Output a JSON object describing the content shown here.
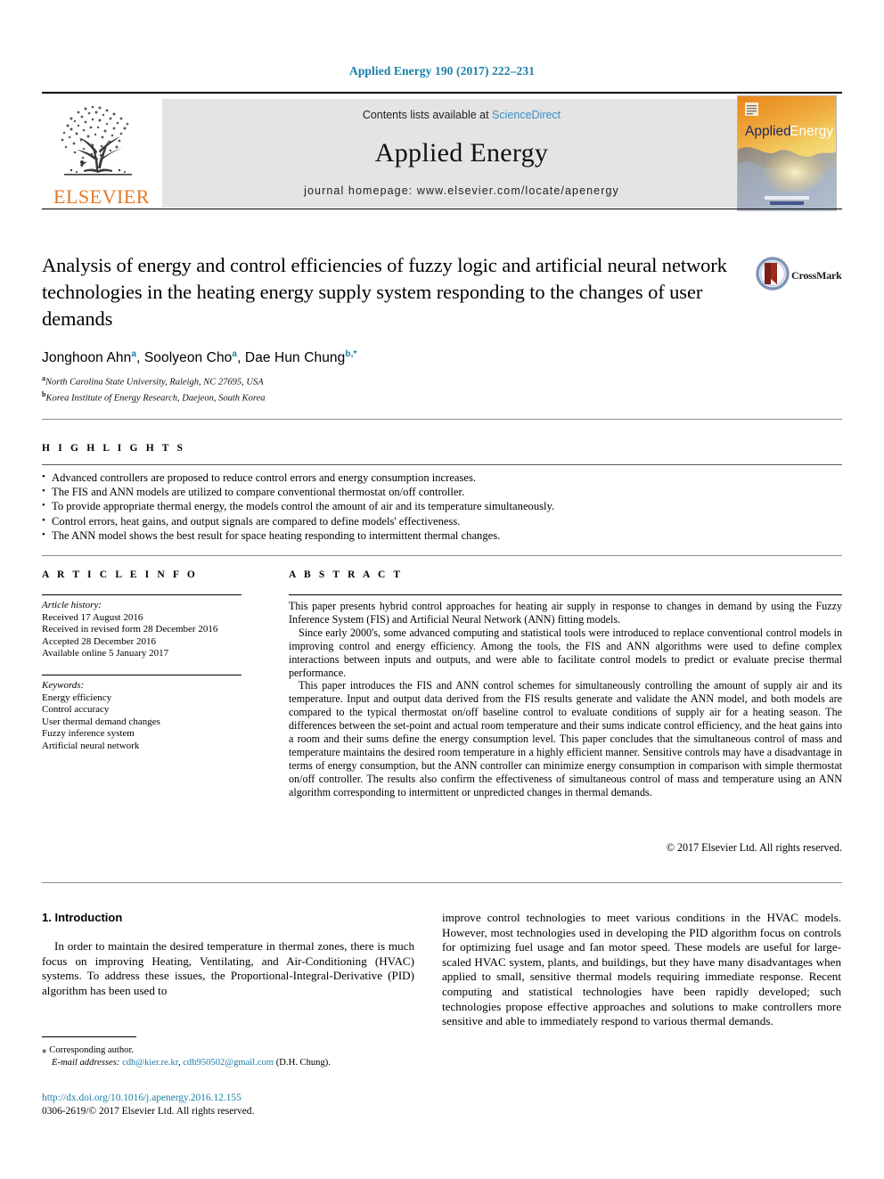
{
  "running_head": "Applied Energy 190 (2017) 222–231",
  "masthead": {
    "publisher": "ELSEVIER",
    "contents_prefix": "Contents lists available at ",
    "contents_link": "ScienceDirect",
    "journal_title": "Applied Energy",
    "homepage": "journal homepage: www.elsevier.com/locate/apenergy",
    "cover_title_first": "Applied",
    "cover_title_second": "Energy"
  },
  "article": {
    "title": "Analysis of energy and control efficiencies of fuzzy logic and artificial neural network technologies in the heating energy supply system responding to the changes of user demands",
    "crossmark_label": "CrossMark",
    "authors": [
      {
        "name": "Jonghoon Ahn",
        "marks": "a",
        "sep": ", "
      },
      {
        "name": "Soolyeon Cho",
        "marks": "a",
        "sep": ", "
      },
      {
        "name": "Dae Hun Chung",
        "marks": "b,*",
        "sep": ""
      }
    ],
    "affiliations": [
      {
        "mark": "a",
        "text": "North Carolina State University, Raleigh, NC 27695, USA"
      },
      {
        "mark": "b",
        "text": "Korea Institute of Energy Research, Daejeon, South Korea"
      }
    ]
  },
  "highlights": {
    "heading": "H I G H L I G H T S",
    "items": [
      "Advanced controllers are proposed to reduce control errors and energy consumption increases.",
      "The FIS and ANN models are utilized to compare conventional thermostat on/off controller.",
      "To provide appropriate thermal energy, the models control the amount of air and its temperature simultaneously.",
      "Control errors, heat gains, and output signals are compared to define models' effectiveness.",
      "The ANN model shows the best result for space heating responding to intermittent thermal changes."
    ]
  },
  "article_info": {
    "heading": "A R T I C L E  I N F O",
    "history_label": "Article history:",
    "history": [
      "Received 17 August 2016",
      "Received in revised form 28 December 2016",
      "Accepted 28 December 2016",
      "Available online 5 January 2017"
    ],
    "keywords_label": "Keywords:",
    "keywords": [
      "Energy efficiency",
      "Control accuracy",
      "User thermal demand changes",
      "Fuzzy inference system",
      "Artificial neural network"
    ]
  },
  "abstract": {
    "heading": "A B S T R A C T",
    "paragraphs": [
      "This paper presents hybrid control approaches for heating air supply in response to changes in demand by using the Fuzzy Inference System (FIS) and Artificial Neural Network (ANN) fitting models.",
      "Since early 2000's, some advanced computing and statistical tools were introduced to replace conventional control models in improving control and energy efficiency. Among the tools, the FIS and ANN algorithms were used to define complex interactions between inputs and outputs, and were able to facilitate control models to predict or evaluate precise thermal performance.",
      "This paper introduces the FIS and ANN control schemes for simultaneously controlling the amount of supply air and its temperature. Input and output data derived from the FIS results generate and validate the ANN model, and both models are compared to the typical thermostat on/off baseline control to evaluate conditions of supply air for a heating season. The differences between the set-point and actual room temperature and their sums indicate control efficiency, and the heat gains into a room and their sums define the energy consumption level. This paper concludes that the simultaneous control of mass and temperature maintains the desired room temperature in a highly efficient manner. Sensitive controls may have a disadvantage in terms of energy consumption, but the ANN controller can minimize energy consumption in comparison with simple thermostat on/off controller. The results also confirm the effectiveness of simultaneous control of mass and temperature using an ANN algorithm corresponding to intermittent or unpredicted changes in thermal demands."
    ],
    "copyright": "© 2017 Elsevier Ltd. All rights reserved."
  },
  "body": {
    "section_title": "1. Introduction",
    "left_paragraph": "In order to maintain the desired temperature in thermal zones, there is much focus on improving Heating, Ventilating, and Air-Conditioning (HVAC) systems. To address these issues, the Proportional-Integral-Derivative (PID) algorithm has been used to",
    "right_paragraph": "improve control technologies to meet various conditions in the HVAC models. However, most technologies used in developing the PID algorithm focus on controls for optimizing fuel usage and fan motor speed. These models are useful for large-scaled HVAC system, plants, and buildings, but they have many disadvantages when applied to small, sensitive thermal models requiring immediate response. Recent computing and statistical technologies have been rapidly developed; such technologies propose effective approaches and solutions to make controllers more sensitive and able to immediately respond to various thermal demands."
  },
  "footer": {
    "corresponding_marker": "⁎",
    "corresponding_text": "Corresponding author.",
    "email_label": "E-mail addresses:",
    "email_1": "cdh@kier.re.kr",
    "email_sep": ", ",
    "email_2": "cdh950502@gmail.com",
    "email_owner": "(D.H. Chung).",
    "doi": "http://dx.doi.org/10.1016/j.apenergy.2016.12.155",
    "issn_line_prefix": "0306-2619/",
    "issn_line_rest": "© 2017 Elsevier Ltd. All rights reserved."
  },
  "colors": {
    "link_blue": "#1a7fa8",
    "sciencedirect_blue": "#3b8fc4",
    "elsevier_orange": "#E87722",
    "banner_gray": "#e4e4e4",
    "crossmark_red": "#9b2a1f"
  }
}
